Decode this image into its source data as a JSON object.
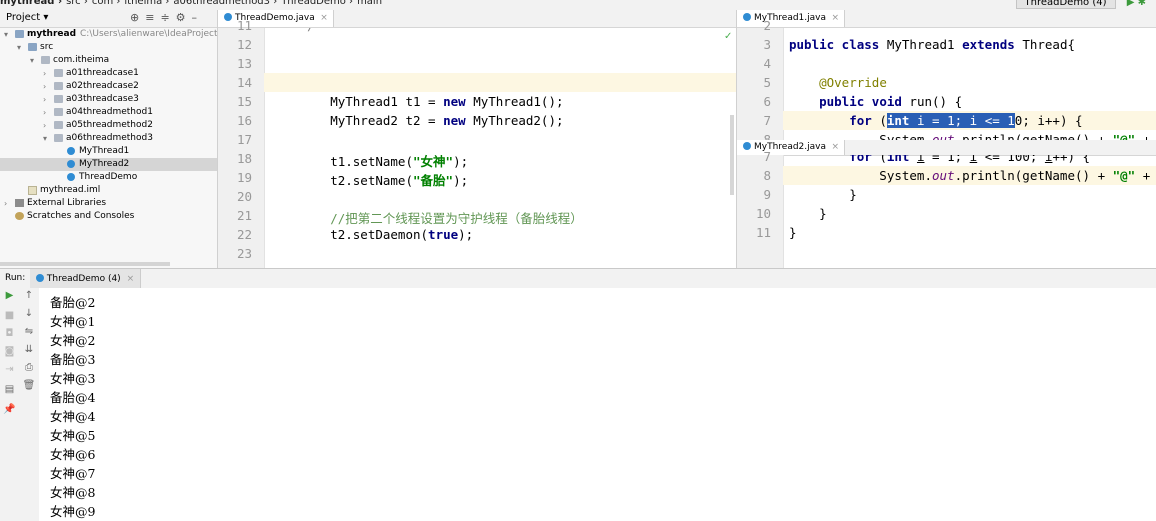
{
  "breadcrumb": [
    "mythread",
    "src",
    "com",
    "itheima",
    "a06threadmethod3",
    "ThreadDemo",
    "main"
  ],
  "toolbar": {
    "run_config": "ThreadDemo (4)"
  },
  "project": {
    "title": "Project",
    "tree": [
      {
        "label": "mythread",
        "path": "C:\\Users\\alienware\\IdeaProjects\\basic-",
        "icon": "module-folder-icon",
        "indent": 0,
        "arrow": "▾",
        "bold": true
      },
      {
        "label": "src",
        "icon": "source-folder-icon",
        "indent": 1,
        "arrow": "▾"
      },
      {
        "label": "com.itheima",
        "icon": "package-icon",
        "indent": 2,
        "arrow": "▾"
      },
      {
        "label": "a01threadcase1",
        "icon": "package-icon",
        "indent": 3,
        "arrow": "›"
      },
      {
        "label": "a02threadcase2",
        "icon": "package-icon",
        "indent": 3,
        "arrow": "›"
      },
      {
        "label": "a03threadcase3",
        "icon": "package-icon",
        "indent": 3,
        "arrow": "›"
      },
      {
        "label": "a04threadmethod1",
        "icon": "package-icon",
        "indent": 3,
        "arrow": "›"
      },
      {
        "label": "a05threadmethod2",
        "icon": "package-icon",
        "indent": 3,
        "arrow": "›"
      },
      {
        "label": "a06threadmethod3",
        "icon": "package-icon",
        "indent": 3,
        "arrow": "▾"
      },
      {
        "label": "MyThread1",
        "icon": "class-icon",
        "indent": 4,
        "arrow": ""
      },
      {
        "label": "MyThread2",
        "icon": "class-icon",
        "indent": 4,
        "arrow": "",
        "selected": true
      },
      {
        "label": "ThreadDemo",
        "icon": "class-icon",
        "indent": 4,
        "arrow": ""
      },
      {
        "label": "mythread.iml",
        "icon": "iml-file-icon",
        "indent": 1,
        "arrow": ""
      },
      {
        "label": "External Libraries",
        "icon": "library-icon",
        "indent": 0,
        "arrow": "›"
      },
      {
        "label": "Scratches and Consoles",
        "icon": "scratch-icon",
        "indent": 0,
        "arrow": ""
      }
    ]
  },
  "editor_left": {
    "tab": "ThreadDemo.java",
    "lines": [
      {
        "n": "11",
        "html": "    <span class='cmt'>*/</span>"
      },
      {
        "n": "12",
        "html": ""
      },
      {
        "n": "13",
        "html": ""
      },
      {
        "n": "14",
        "html": "",
        "current": true
      },
      {
        "n": "15",
        "html": "        MyThread1 t1 = <span class='kw'>new</span> MyThread1();"
      },
      {
        "n": "16",
        "html": "        MyThread2 t2 = <span class='kw'>new</span> MyThread2();"
      },
      {
        "n": "17",
        "html": ""
      },
      {
        "n": "18",
        "html": "        t1.setName(<span class='str'>\"女神\"</span>);"
      },
      {
        "n": "19",
        "html": "        t2.setName(<span class='str'>\"备胎\"</span>);"
      },
      {
        "n": "20",
        "html": ""
      },
      {
        "n": "21",
        "html": "        <span class='cmtcn'>//把第二个线程设置为守护线程（备胎线程）</span>"
      },
      {
        "n": "22",
        "html": "        t2.setDaemon(<span class='kw'>true</span>);"
      },
      {
        "n": "23",
        "html": ""
      }
    ]
  },
  "editor_right_top": {
    "tab": "MyThread1.java",
    "lines": [
      {
        "n": "2",
        "html": ""
      },
      {
        "n": "3",
        "html": "<span class='kw'>public class</span> MyThread1 <span class='kw'>extends</span> Thread{"
      },
      {
        "n": "4",
        "html": ""
      },
      {
        "n": "5",
        "html": "    <span class='ann'>@Override</span>"
      },
      {
        "n": "6",
        "html": "    <span class='kw'>public void</span> run() {"
      },
      {
        "n": "7",
        "html": "        <span class='kw'>for</span> (<span class='sel-text'><b>int</b> i = 1; i &lt;= 1</span>0; i++) {",
        "current": true
      },
      {
        "n": "8",
        "html": "            System.<span class='static'>out</span>.println(getName() + <span class='str'>\"@\"</span> + i);"
      }
    ]
  },
  "editor_right_bottom": {
    "tab": "MyThread2.java",
    "lines": [
      {
        "n": "7",
        "html": "        <span class='kw'>for</span> (<span class='kw'>int</span> <u>i</u> = 1; <u>i</u> &lt;= 100; <u>i</u>++) {"
      },
      {
        "n": "8",
        "html": "            System.<span class='static'>out</span>.println(getName() + <span class='str'>\"@\"</span> + i);",
        "current": true
      },
      {
        "n": "9",
        "html": "        }"
      },
      {
        "n": "10",
        "html": "    }"
      },
      {
        "n": "11",
        "html": "}"
      }
    ]
  },
  "run": {
    "label": "Run:",
    "tab": "ThreadDemo (4)",
    "output": [
      "备胎@2",
      "女神@1",
      "女神@2",
      "备胎@3",
      "女神@3",
      "备胎@4",
      "女神@4",
      "女神@5",
      "女神@6",
      "女神@7",
      "女神@8",
      "女神@9"
    ]
  }
}
